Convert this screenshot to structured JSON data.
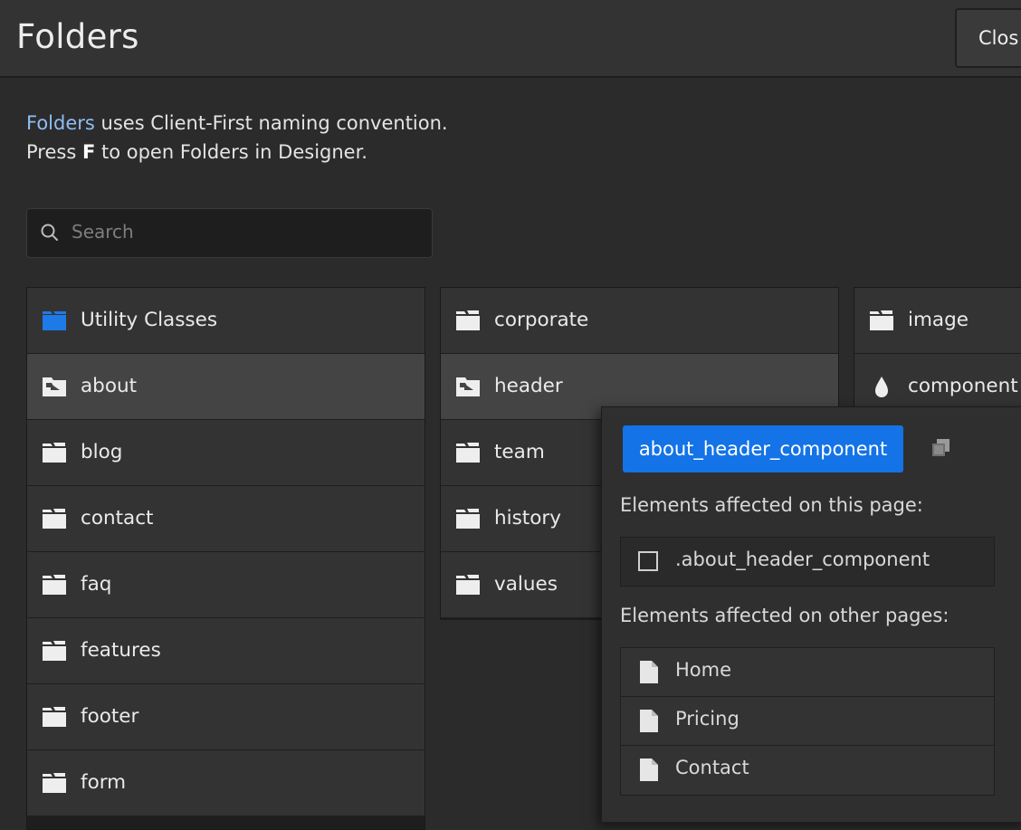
{
  "header": {
    "title": "Folders",
    "close_label": "Clos"
  },
  "info": {
    "link": "Folders",
    "line1_rest": " uses Client-First naming convention.",
    "line2_pre": "Press ",
    "line2_key": "F",
    "line2_post": " to open Folders in Designer."
  },
  "search": {
    "placeholder": "Search"
  },
  "columns": {
    "col1": [
      "Utility Classes",
      "about",
      "blog",
      "contact",
      "faq",
      "features",
      "footer",
      "form"
    ],
    "col2": [
      "corporate",
      "header",
      "team",
      "history",
      "values"
    ],
    "col3": [
      "image",
      "component"
    ]
  },
  "popup": {
    "class_name": "about_header_component",
    "this_page_label": "Elements affected on this page:",
    "this_page_element": ".about_header_component",
    "other_pages_label": "Elements affected on other pages:",
    "other_pages": [
      "Home",
      "Pricing",
      "Contact"
    ]
  },
  "colors": {
    "accent": "#1473e6",
    "link": "#8fbdf3",
    "utility_folder_icon": "#1e7ae6"
  }
}
